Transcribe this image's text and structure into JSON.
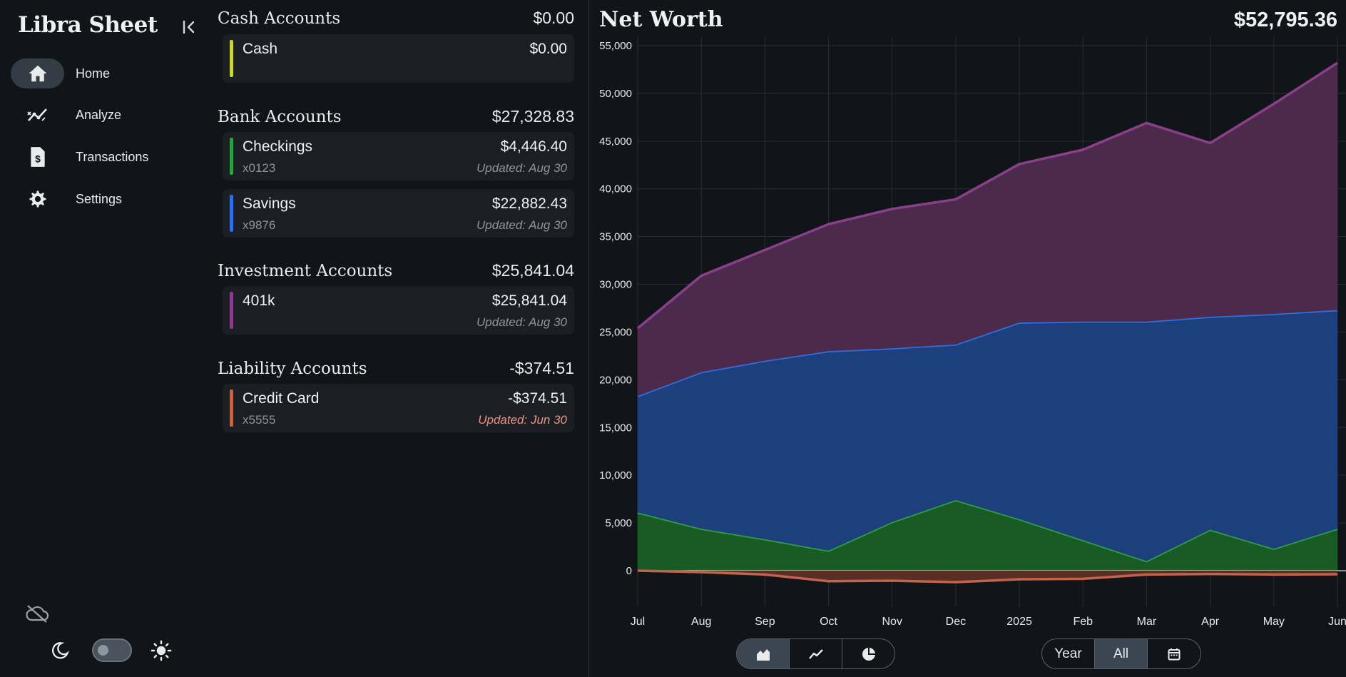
{
  "app": {
    "title": "Libra Sheet"
  },
  "nav": [
    {
      "label": "Home",
      "icon": "home-icon",
      "active": true
    },
    {
      "label": "Analyze",
      "icon": "analyze-icon",
      "active": false
    },
    {
      "label": "Transactions",
      "icon": "receipt-icon",
      "active": false
    },
    {
      "label": "Settings",
      "icon": "gear-icon",
      "active": false
    }
  ],
  "groups": {
    "cash": {
      "title": "Cash Accounts",
      "total": "$0.00"
    },
    "bank": {
      "title": "Bank Accounts",
      "total": "$27,328.83"
    },
    "investment": {
      "title": "Investment Accounts",
      "total": "$25,841.04"
    },
    "liability": {
      "title": "Liability Accounts",
      "total": "-$374.51"
    }
  },
  "accounts": {
    "cash": {
      "name": "Cash",
      "balance": "$0.00",
      "number": "",
      "updated": "",
      "color": "#c8d43a"
    },
    "checkings": {
      "name": "Checkings",
      "balance": "$4,446.40",
      "number": "x0123",
      "updated": "Updated: Aug 30",
      "color": "#2ea043"
    },
    "savings": {
      "name": "Savings",
      "balance": "$22,882.43",
      "number": "x9876",
      "updated": "Updated: Aug 30",
      "color": "#2f6fe0"
    },
    "k401": {
      "name": "401k",
      "balance": "$25,841.04",
      "number": "",
      "updated": "Updated: Aug 30",
      "color": "#8a3f8a"
    },
    "credit": {
      "name": "Credit Card",
      "balance": "-$374.51",
      "number": "x5555",
      "updated": "Updated: Jun 30",
      "color": "#c0644a"
    }
  },
  "networth": {
    "title": "Net Worth",
    "value": "$52,795.36"
  },
  "chart_data": {
    "type": "area",
    "stacked": true,
    "categories": [
      "Jul",
      "Aug",
      "Sep",
      "Oct",
      "Nov",
      "Dec",
      "2025",
      "Feb",
      "Mar",
      "Apr",
      "May",
      "Jun"
    ],
    "ylim": [
      0,
      55000
    ],
    "yticks": [
      "0",
      "5,000",
      "10,000",
      "15,000",
      "20,000",
      "25,000",
      "30,000",
      "35,000",
      "40,000",
      "45,000",
      "50,000",
      "55,000"
    ],
    "grid": true,
    "series": [
      {
        "color": "#2ea043",
        "fill": "#1a5a24",
        "values": [
          6100,
          4400,
          3300,
          2100,
          5100,
          7400,
          5400,
          3200,
          1000,
          4300,
          2300,
          4400
        ]
      },
      {
        "color": "#2f6fe0",
        "fill": "#1d3f7c",
        "values": [
          12200,
          16400,
          18700,
          20900,
          18200,
          16300,
          20600,
          22900,
          25100,
          22300,
          24600,
          22900
        ]
      },
      {
        "color": "#8a3f8a",
        "fill": "#4c2a4c",
        "values": [
          7100,
          10100,
          11600,
          13300,
          14600,
          15200,
          16600,
          18000,
          20800,
          18200,
          22000,
          25900
        ]
      }
    ],
    "negative_series": [
      {
        "color": "#c0644a",
        "values": [
          0,
          -150,
          -400,
          -1100,
          -1050,
          -1200,
          -900,
          -850,
          -400,
          -350,
          -400,
          -374
        ]
      }
    ]
  },
  "controls": {
    "chart_types": [
      {
        "icon": "stacked-area-icon",
        "active": true
      },
      {
        "icon": "line-chart-icon",
        "active": false
      },
      {
        "icon": "pie-chart-icon",
        "active": false
      }
    ],
    "ranges": [
      {
        "label": "Year",
        "active": false
      },
      {
        "label": "All",
        "active": true
      }
    ],
    "calendar_icon": "calendar-icon"
  }
}
